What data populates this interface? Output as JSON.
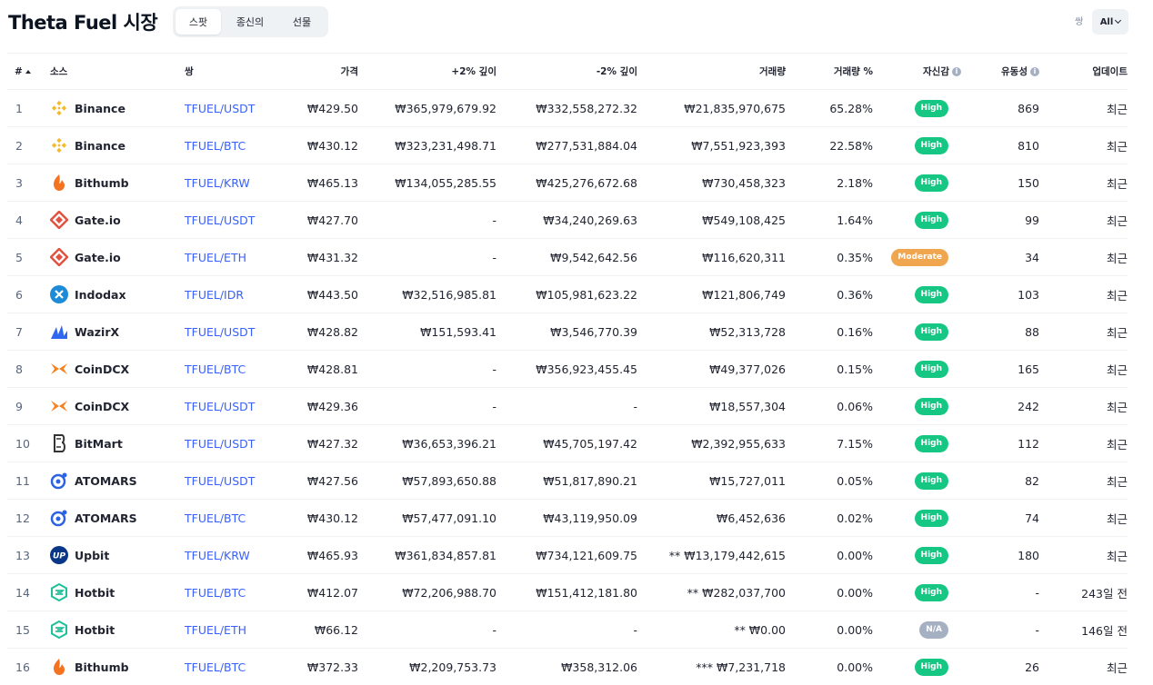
{
  "page_title": "Theta Fuel 시장",
  "tabs": [
    {
      "label": "스팟",
      "active": true
    },
    {
      "label": "종신의",
      "active": false
    },
    {
      "label": "선물",
      "active": false
    }
  ],
  "pair_filter": {
    "label": "쌍",
    "value": "All"
  },
  "columns": {
    "rank": "#",
    "source": "소스",
    "pair": "쌍",
    "price": "가격",
    "depth_plus": "+2% 깊이",
    "depth_minus": "-2% 깊이",
    "volume": "거래량",
    "volume_pct": "거래량 %",
    "confidence": "자신감",
    "liquidity": "유동성",
    "updated": "업데이트"
  },
  "badge_colors": {
    "High": "#16c784",
    "Moderate": "#f0a64f",
    "N/A": "#a6b0c3"
  },
  "rows": [
    {
      "rank": "1",
      "source": "Binance",
      "logo": "binance-logo",
      "pair": "TFUEL/USDT",
      "price": "₩429.50",
      "depth_plus": "₩365,979,679.92",
      "depth_minus": "₩332,558,272.32",
      "volume": "₩21,835,970,675",
      "volume_pct": "65.28%",
      "confidence": "High",
      "liquidity": "869",
      "updated": "최근"
    },
    {
      "rank": "2",
      "source": "Binance",
      "logo": "binance-logo",
      "pair": "TFUEL/BTC",
      "price": "₩430.12",
      "depth_plus": "₩323,231,498.71",
      "depth_minus": "₩277,531,884.04",
      "volume": "₩7,551,923,393",
      "volume_pct": "22.58%",
      "confidence": "High",
      "liquidity": "810",
      "updated": "최근"
    },
    {
      "rank": "3",
      "source": "Bithumb",
      "logo": "bithumb-logo",
      "pair": "TFUEL/KRW",
      "price": "₩465.13",
      "depth_plus": "₩134,055,285.55",
      "depth_minus": "₩425,276,672.68",
      "volume": "₩730,458,323",
      "volume_pct": "2.18%",
      "confidence": "High",
      "liquidity": "150",
      "updated": "최근"
    },
    {
      "rank": "4",
      "source": "Gate.io",
      "logo": "gateio-logo",
      "pair": "TFUEL/USDT",
      "price": "₩427.70",
      "depth_plus": "-",
      "depth_minus": "₩34,240,269.63",
      "volume": "₩549,108,425",
      "volume_pct": "1.64%",
      "confidence": "High",
      "liquidity": "99",
      "updated": "최근"
    },
    {
      "rank": "5",
      "source": "Gate.io",
      "logo": "gateio-logo",
      "pair": "TFUEL/ETH",
      "price": "₩431.32",
      "depth_plus": "-",
      "depth_minus": "₩9,542,642.56",
      "volume": "₩116,620,311",
      "volume_pct": "0.35%",
      "confidence": "Moderate",
      "liquidity": "34",
      "updated": "최근"
    },
    {
      "rank": "6",
      "source": "Indodax",
      "logo": "indodax-logo",
      "pair": "TFUEL/IDR",
      "price": "₩443.50",
      "depth_plus": "₩32,516,985.81",
      "depth_minus": "₩105,981,623.22",
      "volume": "₩121,806,749",
      "volume_pct": "0.36%",
      "confidence": "High",
      "liquidity": "103",
      "updated": "최근"
    },
    {
      "rank": "7",
      "source": "WazirX",
      "logo": "wazirx-logo",
      "pair": "TFUEL/USDT",
      "price": "₩428.82",
      "depth_plus": "₩151,593.41",
      "depth_minus": "₩3,546,770.39",
      "volume": "₩52,313,728",
      "volume_pct": "0.16%",
      "confidence": "High",
      "liquidity": "88",
      "updated": "최근"
    },
    {
      "rank": "8",
      "source": "CoinDCX",
      "logo": "coindcx-logo",
      "pair": "TFUEL/BTC",
      "price": "₩428.81",
      "depth_plus": "-",
      "depth_minus": "₩356,923,455.45",
      "volume": "₩49,377,026",
      "volume_pct": "0.15%",
      "confidence": "High",
      "liquidity": "165",
      "updated": "최근"
    },
    {
      "rank": "9",
      "source": "CoinDCX",
      "logo": "coindcx-logo",
      "pair": "TFUEL/USDT",
      "price": "₩429.36",
      "depth_plus": "-",
      "depth_minus": "-",
      "volume": "₩18,557,304",
      "volume_pct": "0.06%",
      "confidence": "High",
      "liquidity": "242",
      "updated": "최근"
    },
    {
      "rank": "10",
      "source": "BitMart",
      "logo": "bitmart-logo",
      "pair": "TFUEL/USDT",
      "price": "₩427.32",
      "depth_plus": "₩36,653,396.21",
      "depth_minus": "₩45,705,197.42",
      "volume": "₩2,392,955,633",
      "volume_pct": "7.15%",
      "confidence": "High",
      "liquidity": "112",
      "updated": "최근"
    },
    {
      "rank": "11",
      "source": "ATOMARS",
      "logo": "atomars-logo",
      "pair": "TFUEL/USDT",
      "price": "₩427.56",
      "depth_plus": "₩57,893,650.88",
      "depth_minus": "₩51,817,890.21",
      "volume": "₩15,727,011",
      "volume_pct": "0.05%",
      "confidence": "High",
      "liquidity": "82",
      "updated": "최근"
    },
    {
      "rank": "12",
      "source": "ATOMARS",
      "logo": "atomars-logo",
      "pair": "TFUEL/BTC",
      "price": "₩430.12",
      "depth_plus": "₩57,477,091.10",
      "depth_minus": "₩43,119,950.09",
      "volume": "₩6,452,636",
      "volume_pct": "0.02%",
      "confidence": "High",
      "liquidity": "74",
      "updated": "최근"
    },
    {
      "rank": "13",
      "source": "Upbit",
      "logo": "upbit-logo",
      "pair": "TFUEL/KRW",
      "price": "₩465.93",
      "depth_plus": "₩361,834,857.81",
      "depth_minus": "₩734,121,609.75",
      "volume": "** ₩13,179,442,615",
      "volume_pct": "0.00%",
      "confidence": "High",
      "liquidity": "180",
      "updated": "최근"
    },
    {
      "rank": "14",
      "source": "Hotbit",
      "logo": "hotbit-logo",
      "pair": "TFUEL/BTC",
      "price": "₩412.07",
      "depth_plus": "₩72,206,988.70",
      "depth_minus": "₩151,412,181.80",
      "volume": "** ₩282,037,700",
      "volume_pct": "0.00%",
      "confidence": "High",
      "liquidity": "-",
      "updated": "243일 전"
    },
    {
      "rank": "15",
      "source": "Hotbit",
      "logo": "hotbit-logo",
      "pair": "TFUEL/ETH",
      "price": "₩66.12",
      "depth_plus": "-",
      "depth_minus": "-",
      "volume": "** ₩0.00",
      "volume_pct": "0.00%",
      "confidence": "N/A",
      "liquidity": "-",
      "updated": "146일 전"
    },
    {
      "rank": "16",
      "source": "Bithumb",
      "logo": "bithumb-logo",
      "pair": "TFUEL/BTC",
      "price": "₩372.33",
      "depth_plus": "₩2,209,753.73",
      "depth_minus": "₩358,312.06",
      "volume": "*** ₩7,231,718",
      "volume_pct": "0.00%",
      "confidence": "High",
      "liquidity": "26",
      "updated": "최근"
    }
  ]
}
